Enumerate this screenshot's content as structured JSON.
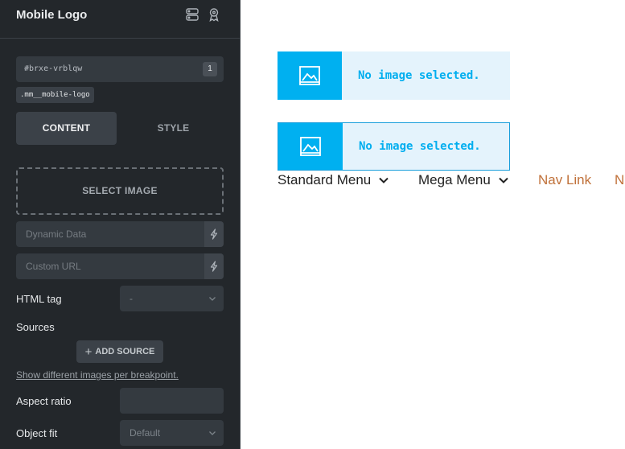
{
  "panel": {
    "title": "Mobile Logo",
    "element_id": "#brxe-vrblqw",
    "id_badge": "1",
    "class_chip": ".mm__mobile-logo",
    "tabs": [
      {
        "label": "CONTENT",
        "active": true
      },
      {
        "label": "STYLE",
        "active": false
      }
    ],
    "select_image_label": "SELECT IMAGE",
    "dynamic_data_placeholder": "Dynamic Data",
    "custom_url_placeholder": "Custom URL",
    "html_tag_label": "HTML tag",
    "html_tag_value": "-",
    "sources_label": "Sources",
    "add_source_label": "ADD SOURCE",
    "breakpoint_link": "Show different images per breakpoint.",
    "aspect_ratio_label": "Aspect ratio",
    "aspect_ratio_value": "",
    "object_fit_label": "Object fit",
    "object_fit_value": "Default",
    "icons": [
      "structure-icon",
      "accessibility-icon",
      "bolt-icon",
      "chevron-down-icon"
    ]
  },
  "canvas": {
    "placeholders": [
      {
        "text": "No image selected.",
        "selected": false
      },
      {
        "text": "No image selected.",
        "selected": true
      }
    ],
    "nav": [
      {
        "label": "Standard Menu",
        "has_dropdown": true
      },
      {
        "label": "Mega Menu",
        "has_dropdown": true
      },
      {
        "label": "Nav Link",
        "has_dropdown": false
      },
      {
        "label": "N",
        "has_dropdown": false
      }
    ]
  },
  "colors": {
    "panel_bg": "#23272b",
    "placeholder_accent": "#00b0f0",
    "link_color": "#c0713a"
  }
}
